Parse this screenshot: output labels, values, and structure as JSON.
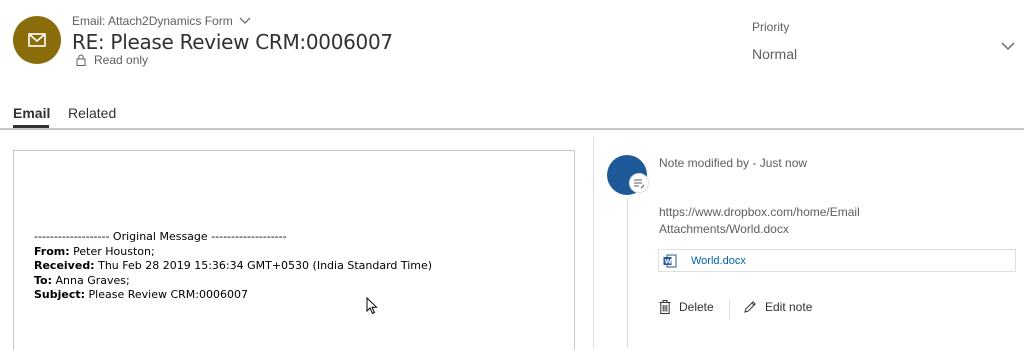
{
  "header": {
    "form_name": "Email: Attach2Dynamics Form",
    "title": "RE: Please Review CRM:0006007",
    "readonly_label": "Read only",
    "priority_label": "Priority",
    "priority_value": "Normal",
    "avatar_color": "#8a6d0a"
  },
  "tabs": [
    {
      "label": "Email",
      "active": true
    },
    {
      "label": "Related",
      "active": false
    }
  ],
  "email_body": {
    "separator": "------------------- Original Message -------------------",
    "from_label": "From:",
    "from_value": "Peter Houston;",
    "received_label": "Received:",
    "received_value": "Thu Feb 28 2019 15:36:34 GMT+0530 (India Standard Time)",
    "to_label": "To:",
    "to_value": "Anna Graves;",
    "subject_label": "Subject:",
    "subject_value": "Please Review CRM:0006007"
  },
  "note": {
    "header": "Note modified by -  Just now",
    "text": "https://www.dropbox.com/home/Email Attachments/World.docx",
    "attachment_name": "World.docx",
    "delete_label": "Delete",
    "edit_label": "Edit note",
    "avatar_color": "#1e5a99",
    "link_color": "#0063b1",
    "word_icon_color": "#2b579a"
  }
}
